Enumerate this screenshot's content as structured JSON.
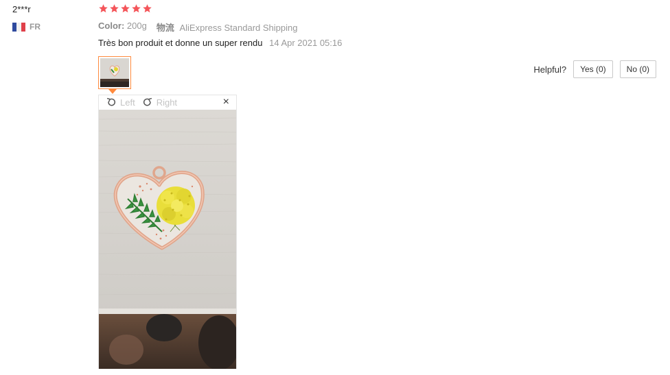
{
  "reviewer": {
    "name": "2***r",
    "country_code": "FR"
  },
  "rating": {
    "stars": 5,
    "max": 5,
    "color": "#f4555a"
  },
  "attributes": {
    "color_key": "Color:",
    "color_value": "200g",
    "shipping_key": "物流",
    "shipping_value": "AliExpress Standard Shipping"
  },
  "review": {
    "text": "Très bon produit et donne un super rendu",
    "date": "14 Apr 2021 05:16"
  },
  "helpful": {
    "label": "Helpful?",
    "yes_label": "Yes (0)",
    "no_label": "No (0)"
  },
  "viewer": {
    "rotate_left_label": "Left",
    "rotate_right_label": "Right",
    "close_label": "×"
  },
  "colors": {
    "accent": "#ff8a3d",
    "muted_text": "#999999"
  }
}
